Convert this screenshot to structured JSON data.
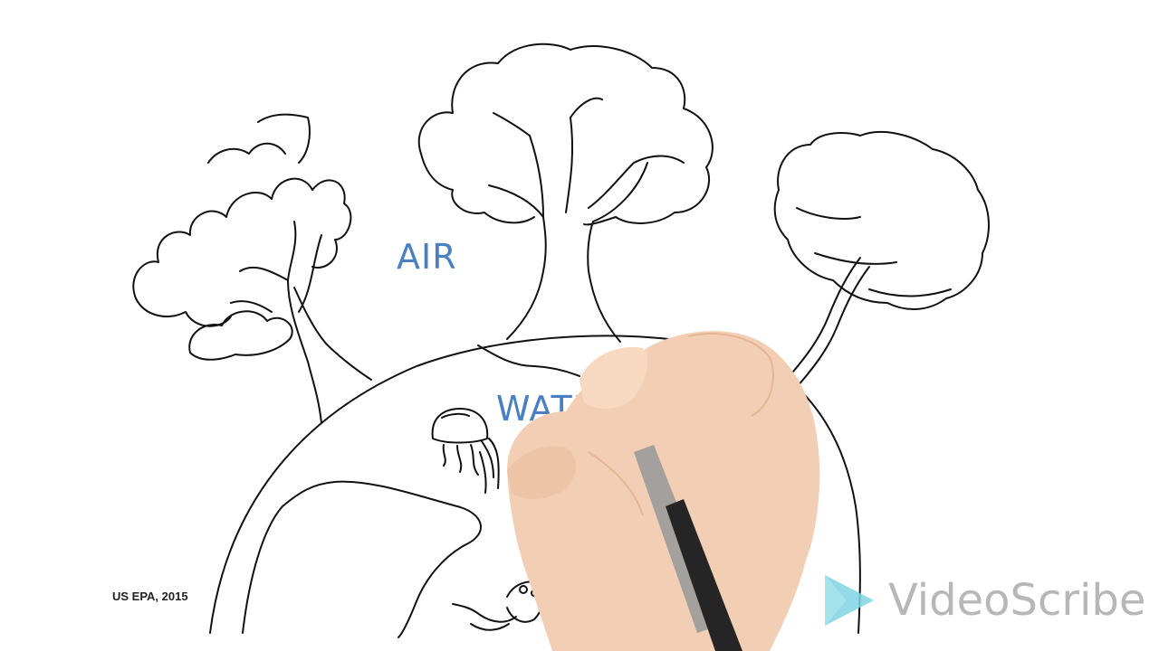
{
  "scene": {
    "labels": {
      "air": "AIR",
      "water": "WATER"
    },
    "citation": "US EPA, 2015",
    "watermark": {
      "brand": "VideoScribe",
      "logo_icon": "play-triangle-icon",
      "logo_color": "#7fd3e3"
    },
    "label_color": "#4a7fc1",
    "drawn_objects": [
      "tree-icon",
      "earth-globe-icon",
      "jellyfish-icon",
      "sea-creature-icon",
      "hand-with-pen-icon"
    ]
  }
}
